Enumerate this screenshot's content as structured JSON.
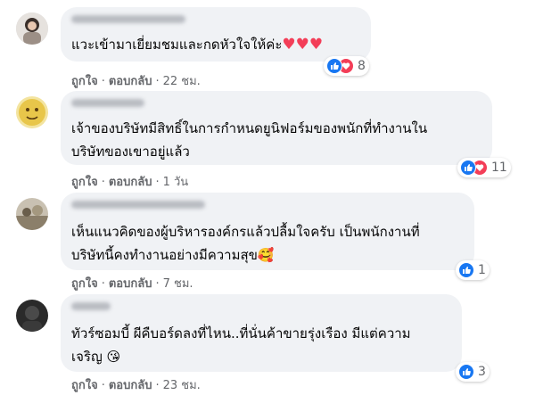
{
  "colors": {
    "like": "#1877f2",
    "love": "#f33e58",
    "bubble": "#f0f2f5",
    "meta": "#65676b"
  },
  "comments": [
    {
      "author": "",
      "lines": [
        "แวะเข้ามาเยี่ยมชมและกดหัวใจให้ค่ะ"
      ],
      "trailing": "♥♥♥",
      "reaction_icons": [
        "like-icon",
        "love-icon"
      ],
      "reaction_count": "8",
      "like_label": "ถูกใจ",
      "reply_label": "ตอบกลับ",
      "time": "22 ชม."
    },
    {
      "author": "",
      "lines": [
        "เจ้าของบริษัทมีสิทธิ์ในการกำหนดยูนิฟอร์มของพนักที่ทำงานใน",
        "บริษัทของเขาอยู่แล้ว"
      ],
      "trailing": "",
      "reaction_icons": [
        "like-icon",
        "love-icon"
      ],
      "reaction_count": "11",
      "like_label": "ถูกใจ",
      "reply_label": "ตอบกลับ",
      "time": "1 วัน"
    },
    {
      "author": "",
      "lines": [
        "เห็นแนวคิดของผู้บริหารองค์กรแล้วปลื้มใจครับ เป็นพนักงานที่",
        "บริษัทนี้คงทำงานอย่างมีความสุข"
      ],
      "trailing": "🥰",
      "reaction_icons": [
        "like-icon"
      ],
      "reaction_count": "1",
      "like_label": "ถูกใจ",
      "reply_label": "ตอบกลับ",
      "time": "7 ชม."
    },
    {
      "author": "",
      "lines": [
        "ทัวร์ซอมบี้ ผีคืบอร์ดลงที่ไหน..ที่นั่นค้าขายรุ่งเรือง มีแต่ความ",
        "เจริญ"
      ],
      "trailing": "😘",
      "reaction_icons": [
        "like-icon"
      ],
      "reaction_count": "3",
      "like_label": "ถูกใจ",
      "reply_label": "ตอบกลับ",
      "time": "23 ชม."
    }
  ]
}
